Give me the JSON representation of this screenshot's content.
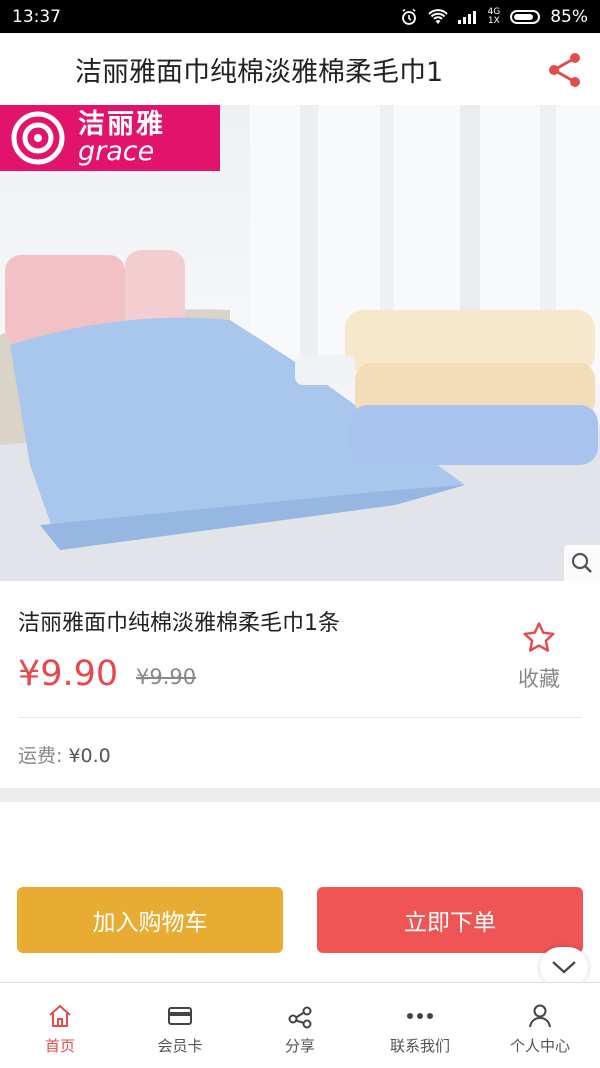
{
  "status_bar": {
    "time": "13:37",
    "network_top": "4G",
    "network_bottom": "1X",
    "battery": "85%",
    "battery_level": 0.85
  },
  "header": {
    "title": "洁丽雅面巾纯棉淡雅棉柔毛巾1"
  },
  "brand": {
    "name_cn": "洁丽雅",
    "name_en": "grace",
    "color": "#e1136c"
  },
  "product": {
    "name": "洁丽雅面巾纯棉淡雅棉柔毛巾1条",
    "price": "¥9.90",
    "original_price": "¥9.90",
    "favorite_label": "收藏",
    "shipping_label": "运费:",
    "shipping_value": "¥0.0"
  },
  "actions": {
    "add_to_cart": "加入购物车",
    "buy_now": "立即下单"
  },
  "tabs": [
    {
      "label": "首页",
      "icon": "home-icon",
      "active": true
    },
    {
      "label": "会员卡",
      "icon": "card-icon",
      "active": false
    },
    {
      "label": "分享",
      "icon": "share-icon",
      "active": false
    },
    {
      "label": "联系我们",
      "icon": "more-dots-icon",
      "active": false
    },
    {
      "label": "个人中心",
      "icon": "person-icon",
      "active": false
    }
  ],
  "colors": {
    "accent": "#e8474e",
    "cart_button": "#e9ac33",
    "buy_button": "#ef5555",
    "active_tab": "#e34c4c"
  }
}
